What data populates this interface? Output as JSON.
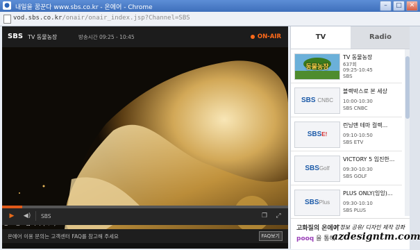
{
  "window": {
    "title": "내일을 꿈꾼다 www.sbs.co.kr - 온에어 - Chrome",
    "buttons": {
      "min": "–",
      "max": "□",
      "close": "✕"
    }
  },
  "address": {
    "url_host": "vod.sbs.co.kr",
    "url_path": "/onair/onair_index.jsp?Channel=SBS"
  },
  "player": {
    "channel": "SBS",
    "program": "TV 동물농장",
    "time_label": "방송시간 09:25 - 10:45",
    "onair": "ON-AIR",
    "ad_label": "광고 종료합니다 (1/3)",
    "control_channel": "SBS",
    "notice": "온에어 이용 문의는 고객센터 FAQ를 참고해 주세요",
    "faq_button": "FAQ보기",
    "progress": 0.07
  },
  "panel": {
    "tabs": [
      {
        "label": "TV",
        "active": true
      },
      {
        "label": "Radio",
        "active": false
      }
    ],
    "items": [
      {
        "title": "TV 동물농장",
        "line2": "637회",
        "line3": "09:25-10:45",
        "line4": "SBS",
        "logo": "동물농장",
        "logo_color": "#2e6a1f"
      },
      {
        "title": "블랙박스로 본 세상",
        "line2": "",
        "line3": "10:00-10:30",
        "line4": "SBS CNBC",
        "logo": "SBS",
        "logo_sub": "CNBC",
        "logo_color": "#1c5aa8"
      },
      {
        "title": "런닝맨 테마 컬렉...",
        "line2": "",
        "line3": "09:10-10:50",
        "line4": "SBS ETV",
        "logo": "SBS",
        "logo_sub": "E!",
        "logo_color": "#1c5aa8"
      },
      {
        "title": "VICTORY 5 임진한...",
        "line2": "",
        "line3": "09:30-10:30",
        "line4": "SBS GOLF",
        "logo": "SBS",
        "logo_sub": "Golf",
        "logo_color": "#1c5aa8"
      },
      {
        "title": "PLUS ONLY(잉잉)...",
        "line2": "",
        "line3": "09:30-10:10",
        "line4": "SBS PLUS",
        "logo": "SBS",
        "logo_sub": "Plus",
        "logo_color": "#1c5aa8"
      }
    ],
    "ad": {
      "line1": "고화질의 온에어",
      "line2_brand": "pooq",
      "line2_rest": " 을 통해"
    }
  },
  "watermark": {
    "main": "azdesigntm.com",
    "sub": "IT정보 공유/ 디자인 제작 강좌"
  }
}
